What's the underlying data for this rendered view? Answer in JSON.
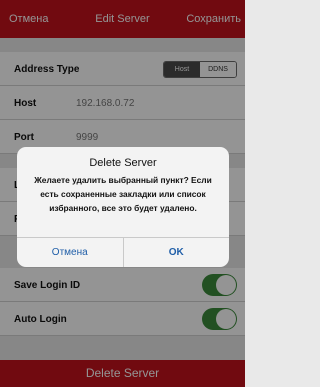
{
  "nav": {
    "cancel_label": "Отмена",
    "title": "Edit Server",
    "save_label": "Сохранить"
  },
  "form": {
    "address_type_label": "Address Type",
    "address_type_options": [
      "Host",
      "DDNS"
    ],
    "address_type_selected": "Host",
    "host_label": "Host",
    "host_value": "192.168.0.72",
    "port_label": "Port",
    "port_value": "9999",
    "login_label_partial": "Lo",
    "password_label_partial": "Pa",
    "save_login_label": "Save Login ID",
    "save_login_on": true,
    "auto_login_label": "Auto Login",
    "auto_login_on": true
  },
  "delete_button_label": "Delete Server",
  "dialog": {
    "title": "Delete Server",
    "message": "Желаете удалить выбранный пункт? Если есть сохраненные закладки или список избранного, все это будет удалено.",
    "cancel_label": "Отмена",
    "ok_label": "OK"
  },
  "colors": {
    "accent": "#c3121d",
    "toggle_on": "#3c8a3c",
    "dialog_button": "#1f5ea8"
  }
}
